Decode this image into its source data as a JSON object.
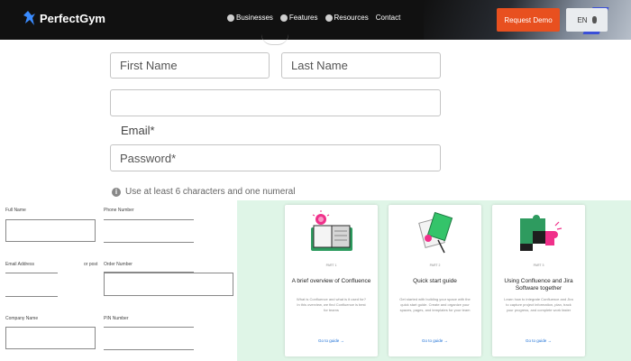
{
  "nav": {
    "brand": "PerfectGym",
    "menu": [
      {
        "label": "Businesses",
        "icon": "globe-icon"
      },
      {
        "label": "Features",
        "icon": "globe-icon"
      },
      {
        "label": "Resources",
        "icon": "globe-icon"
      },
      {
        "label": "Contact",
        "icon": ""
      }
    ],
    "cta": "Request Demo",
    "lang": "EN",
    "cta_color": "#e8501f"
  },
  "signup": {
    "first_name_placeholder": "First Name",
    "last_name_placeholder": "Last Name",
    "email_label": "Email*",
    "password_placeholder": "Password*",
    "hint": "Use at least 6 characters and one numeral"
  },
  "mini_form": {
    "full_name": "Full Name",
    "phone_number": "Phone Number",
    "email_address": "Email Address",
    "email_helper": "or post",
    "order_number": "Order Number",
    "company_name": "Company Name",
    "pin_number": "PIN Number"
  },
  "guides": {
    "background": "#dff5e7",
    "cards": [
      {
        "step": "PART 1",
        "title": "A brief overview of Confluence",
        "desc": "What is Confluence and what is it used for? In this overview, we find Confluence is best for teams",
        "link": "Go to guide →",
        "illustration": "book-lightbulb-icon"
      },
      {
        "step": "PART 2",
        "title": "Quick start guide",
        "desc": "Get started with building your space with the quick start guide. Create and organize your spaces, pages, and templates for your team",
        "link": "Go to guide →",
        "illustration": "pages-icon"
      },
      {
        "step": "PART 3",
        "title": "Using Confluence and Jira Software together",
        "desc": "Learn how to integrate Confluence and Jira to capture project information, plan, track your progress, and complete work faster",
        "link": "Go to guide →",
        "illustration": "puzzle-icon"
      }
    ]
  }
}
